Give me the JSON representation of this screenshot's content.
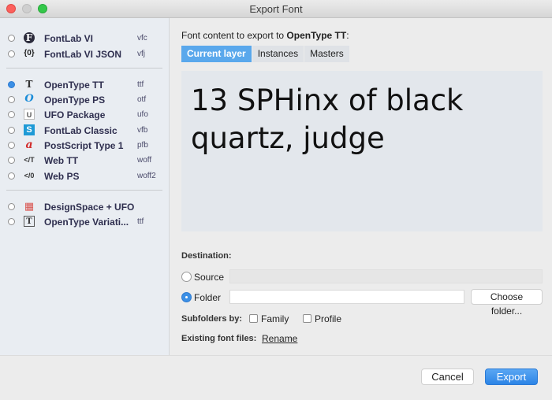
{
  "window": {
    "title": "Export Font"
  },
  "formats": [
    {
      "name": "FontLab VI",
      "ext": "vfc",
      "icon": "fontlab-vi-icon",
      "glyph": "F",
      "selected": false
    },
    {
      "name": "FontLab VI JSON",
      "ext": "vfj",
      "icon": "json-icon",
      "glyph": "{0}",
      "selected": false
    },
    {
      "name": "OpenType TT",
      "ext": "ttf",
      "icon": "truetype-icon",
      "glyph": "T",
      "selected": true
    },
    {
      "name": "OpenType PS",
      "ext": "otf",
      "icon": "opentype-icon",
      "glyph": "O",
      "selected": false
    },
    {
      "name": "UFO Package",
      "ext": "ufo",
      "icon": "ufo-icon",
      "glyph": "U",
      "selected": false
    },
    {
      "name": "FontLab Classic",
      "ext": "vfb",
      "icon": "fontlab-classic-icon",
      "glyph": "S",
      "selected": false
    },
    {
      "name": "PostScript Type 1",
      "ext": "pfb",
      "icon": "postscript-icon",
      "glyph": "a",
      "selected": false
    },
    {
      "name": "Web TT",
      "ext": "woff",
      "icon": "web-tt-icon",
      "glyph": "</T",
      "selected": false
    },
    {
      "name": "Web PS",
      "ext": "woff2",
      "icon": "web-ps-icon",
      "glyph": "</0",
      "selected": false
    },
    {
      "name": "DesignSpace + UFO",
      "ext": "",
      "icon": "designspace-icon",
      "glyph": "▦",
      "selected": false
    },
    {
      "name": "OpenType Variati...",
      "ext": "ttf",
      "icon": "variable-font-icon",
      "glyph": "T",
      "selected": false
    }
  ],
  "content": {
    "label_prefix": "Font content to export to ",
    "label_format": "OpenType TT",
    "label_suffix": ":",
    "tabs": [
      "Current layer",
      "Instances",
      "Masters"
    ],
    "preview_text": "13 SPHinx of black quartz, judge"
  },
  "destination": {
    "label": "Destination:",
    "source_label": "Source",
    "folder_label": "Folder",
    "folder_value": "",
    "choose_button": "Choose folder...",
    "subfolders_label": "Subfolders by:",
    "family_label": "Family",
    "profile_label": "Profile",
    "existing_label": "Existing font files:",
    "existing_value": "Rename"
  },
  "footer": {
    "cancel": "Cancel",
    "export": "Export"
  },
  "colors": {
    "accent": "#3b8fe5",
    "tab_active": "#5aa8ec",
    "preview_bg": "#e3e7ec",
    "sidebar_bg": "#e9edf2"
  }
}
